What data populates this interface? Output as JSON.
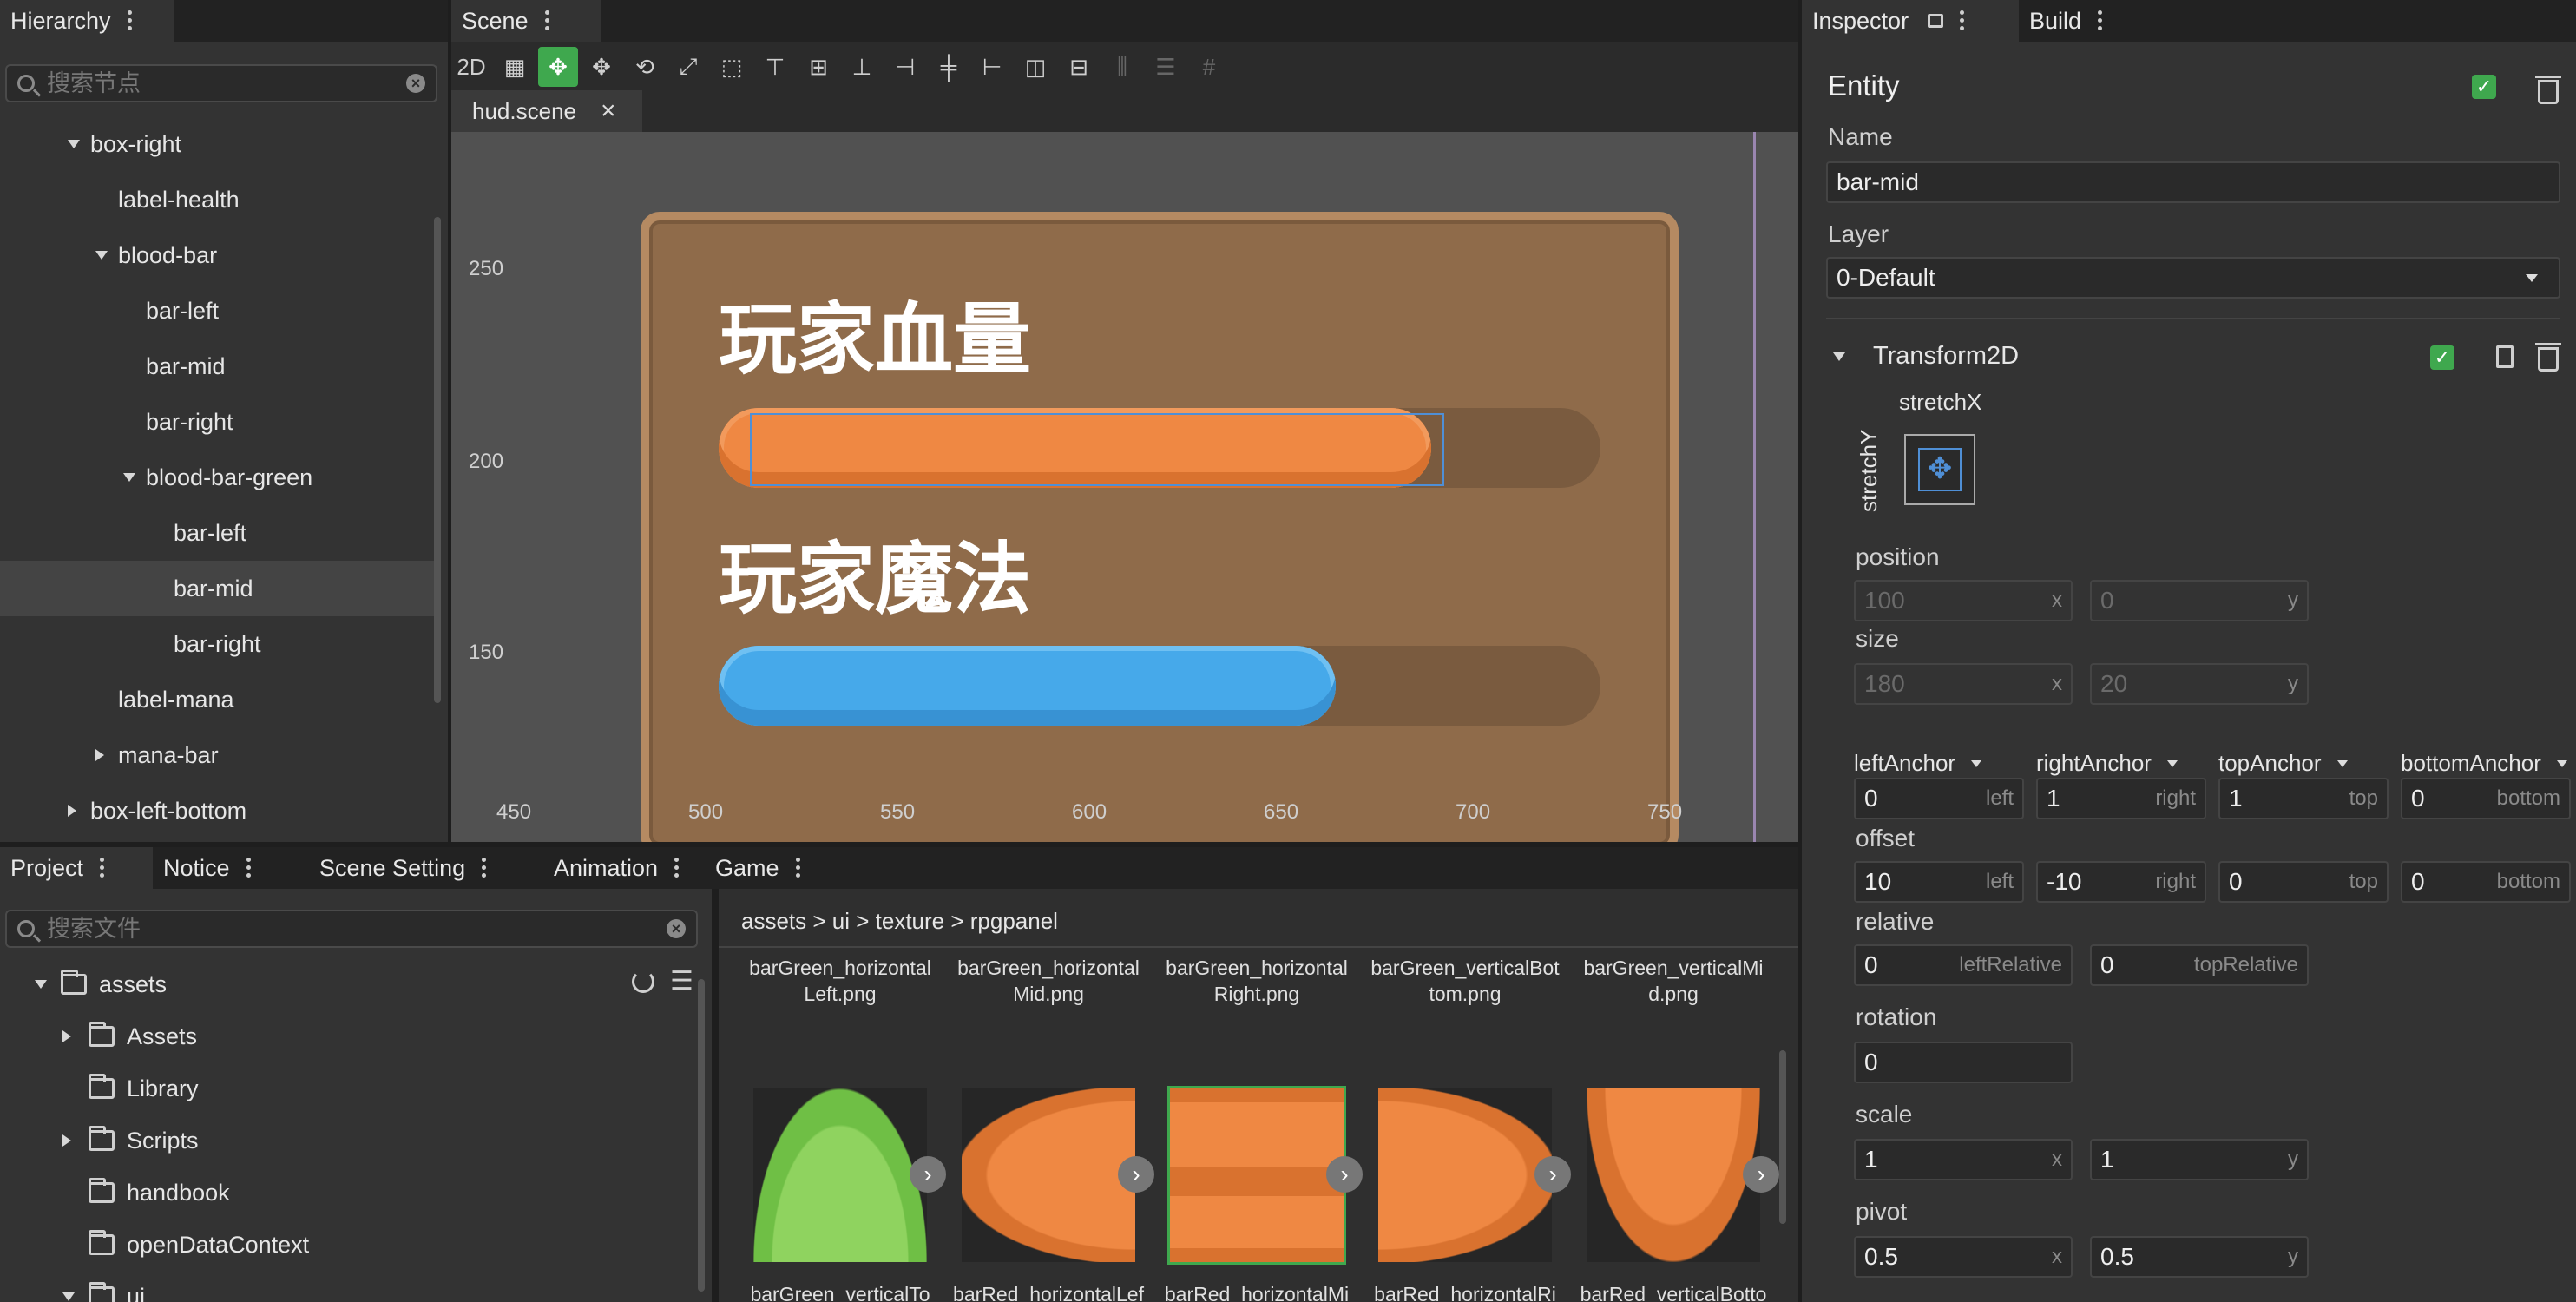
{
  "hierarchy": {
    "tab_label": "Hierarchy",
    "search_placeholder": "搜索节点",
    "nodes": [
      {
        "label": "box-right",
        "depth": 0,
        "expanded": true
      },
      {
        "label": "label-health",
        "depth": 1
      },
      {
        "label": "blood-bar",
        "depth": 1,
        "expanded": true
      },
      {
        "label": "bar-left",
        "depth": 2
      },
      {
        "label": "bar-mid",
        "depth": 2
      },
      {
        "label": "bar-right",
        "depth": 2
      },
      {
        "label": "blood-bar-green",
        "depth": 2,
        "expanded": true
      },
      {
        "label": "bar-left",
        "depth": 3
      },
      {
        "label": "bar-mid",
        "depth": 3,
        "selected": true
      },
      {
        "label": "bar-right",
        "depth": 3
      },
      {
        "label": "label-mana",
        "depth": 1
      },
      {
        "label": "mana-bar",
        "depth": 1,
        "collapsed": true
      },
      {
        "label": "box-left-bottom",
        "depth": 0,
        "collapsed": true
      }
    ]
  },
  "scene": {
    "tab_label": "Scene",
    "mode_label": "2D",
    "file_tab": "hud.scene",
    "title_health": "玩家血量",
    "title_mana": "玩家魔法",
    "health_fill": 0.86,
    "mana_fill": 0.7,
    "ruler_y": [
      "250",
      "200",
      "150"
    ],
    "ruler_x": [
      "450",
      "500",
      "550",
      "600",
      "650",
      "700",
      "750"
    ],
    "colors": {
      "health": "#ef8843",
      "mana": "#46a9ea",
      "panel": "#8f6b4a",
      "accent": "#3fa84e"
    }
  },
  "inspector": {
    "tab_label": "Inspector",
    "build_tab": "Build",
    "entity_label": "Entity",
    "name_label": "Name",
    "name_value": "bar-mid",
    "layer_label": "Layer",
    "layer_value": "0-Default",
    "transform_label": "Transform2D",
    "stretch_x": "stretchX",
    "stretch_y": "stretchY",
    "position_label": "position",
    "position_x": "100",
    "position_y": "0",
    "size_label": "size",
    "size_x": "180",
    "size_y": "20",
    "anchors": [
      {
        "label": "leftAnchor",
        "value": "0",
        "suffix": "left"
      },
      {
        "label": "rightAnchor",
        "value": "1",
        "suffix": "right"
      },
      {
        "label": "topAnchor",
        "value": "1",
        "suffix": "top"
      },
      {
        "label": "bottomAnchor",
        "value": "0",
        "suffix": "bottom"
      }
    ],
    "offset_label": "offset",
    "offsets": [
      {
        "value": "10",
        "suffix": "left"
      },
      {
        "value": "-10",
        "suffix": "right"
      },
      {
        "value": "0",
        "suffix": "top"
      },
      {
        "value": "0",
        "suffix": "bottom"
      }
    ],
    "relative_label": "relative",
    "relative_left": "0",
    "relative_left_suffix": "leftRelative",
    "relative_top": "0",
    "relative_top_suffix": "topRelative",
    "rotation_label": "rotation",
    "rotation_value": "0",
    "scale_label": "scale",
    "scale_x": "1",
    "scale_y": "1",
    "pivot_label": "pivot",
    "pivot_x": "0.5",
    "pivot_y": "0.5",
    "x_suffix": "x",
    "y_suffix": "y"
  },
  "bottom_tabs": [
    "Project",
    "Notice",
    "Scene Setting",
    "Animation",
    "Game"
  ],
  "project": {
    "search_placeholder": "搜索文件",
    "tree": [
      {
        "label": "assets",
        "depth": 0,
        "expanded": true
      },
      {
        "label": "Assets",
        "depth": 1,
        "collapsed": true
      },
      {
        "label": "Library",
        "depth": 1
      },
      {
        "label": "Scripts",
        "depth": 1,
        "collapsed": true
      },
      {
        "label": "handbook",
        "depth": 1
      },
      {
        "label": "openDataContext",
        "depth": 1
      },
      {
        "label": "ui",
        "depth": 1,
        "expanded": true
      }
    ]
  },
  "assets_view": {
    "breadcrumb": "assets > ui > texture > rpgpanel",
    "top_row": [
      "barGreen_horizontalLeft.png",
      "barGreen_horizontalMid.png",
      "barGreen_horizontalRight.png",
      "barGreen_verticalBottom.png",
      "barGreen_verticalMid.png"
    ],
    "bottom_row": [
      "barGreen_verticalTop.png",
      "barRed_horizontalLeft.png",
      "barRed_horizontalMid.png",
      "barRed_horizontalRight.png",
      "barRed_verticalBottom.png"
    ]
  }
}
